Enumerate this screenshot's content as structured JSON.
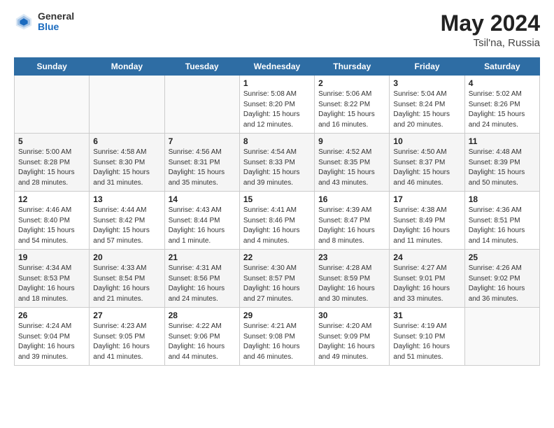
{
  "header": {
    "logo_general": "General",
    "logo_blue": "Blue",
    "month_year": "May 2024",
    "location": "Tsil'na, Russia"
  },
  "weekdays": [
    "Sunday",
    "Monday",
    "Tuesday",
    "Wednesday",
    "Thursday",
    "Friday",
    "Saturday"
  ],
  "weeks": [
    [
      {
        "day": "",
        "info": ""
      },
      {
        "day": "",
        "info": ""
      },
      {
        "day": "",
        "info": ""
      },
      {
        "day": "1",
        "info": "Sunrise: 5:08 AM\nSunset: 8:20 PM\nDaylight: 15 hours\nand 12 minutes."
      },
      {
        "day": "2",
        "info": "Sunrise: 5:06 AM\nSunset: 8:22 PM\nDaylight: 15 hours\nand 16 minutes."
      },
      {
        "day": "3",
        "info": "Sunrise: 5:04 AM\nSunset: 8:24 PM\nDaylight: 15 hours\nand 20 minutes."
      },
      {
        "day": "4",
        "info": "Sunrise: 5:02 AM\nSunset: 8:26 PM\nDaylight: 15 hours\nand 24 minutes."
      }
    ],
    [
      {
        "day": "5",
        "info": "Sunrise: 5:00 AM\nSunset: 8:28 PM\nDaylight: 15 hours\nand 28 minutes."
      },
      {
        "day": "6",
        "info": "Sunrise: 4:58 AM\nSunset: 8:30 PM\nDaylight: 15 hours\nand 31 minutes."
      },
      {
        "day": "7",
        "info": "Sunrise: 4:56 AM\nSunset: 8:31 PM\nDaylight: 15 hours\nand 35 minutes."
      },
      {
        "day": "8",
        "info": "Sunrise: 4:54 AM\nSunset: 8:33 PM\nDaylight: 15 hours\nand 39 minutes."
      },
      {
        "day": "9",
        "info": "Sunrise: 4:52 AM\nSunset: 8:35 PM\nDaylight: 15 hours\nand 43 minutes."
      },
      {
        "day": "10",
        "info": "Sunrise: 4:50 AM\nSunset: 8:37 PM\nDaylight: 15 hours\nand 46 minutes."
      },
      {
        "day": "11",
        "info": "Sunrise: 4:48 AM\nSunset: 8:39 PM\nDaylight: 15 hours\nand 50 minutes."
      }
    ],
    [
      {
        "day": "12",
        "info": "Sunrise: 4:46 AM\nSunset: 8:40 PM\nDaylight: 15 hours\nand 54 minutes."
      },
      {
        "day": "13",
        "info": "Sunrise: 4:44 AM\nSunset: 8:42 PM\nDaylight: 15 hours\nand 57 minutes."
      },
      {
        "day": "14",
        "info": "Sunrise: 4:43 AM\nSunset: 8:44 PM\nDaylight: 16 hours\nand 1 minute."
      },
      {
        "day": "15",
        "info": "Sunrise: 4:41 AM\nSunset: 8:46 PM\nDaylight: 16 hours\nand 4 minutes."
      },
      {
        "day": "16",
        "info": "Sunrise: 4:39 AM\nSunset: 8:47 PM\nDaylight: 16 hours\nand 8 minutes."
      },
      {
        "day": "17",
        "info": "Sunrise: 4:38 AM\nSunset: 8:49 PM\nDaylight: 16 hours\nand 11 minutes."
      },
      {
        "day": "18",
        "info": "Sunrise: 4:36 AM\nSunset: 8:51 PM\nDaylight: 16 hours\nand 14 minutes."
      }
    ],
    [
      {
        "day": "19",
        "info": "Sunrise: 4:34 AM\nSunset: 8:53 PM\nDaylight: 16 hours\nand 18 minutes."
      },
      {
        "day": "20",
        "info": "Sunrise: 4:33 AM\nSunset: 8:54 PM\nDaylight: 16 hours\nand 21 minutes."
      },
      {
        "day": "21",
        "info": "Sunrise: 4:31 AM\nSunset: 8:56 PM\nDaylight: 16 hours\nand 24 minutes."
      },
      {
        "day": "22",
        "info": "Sunrise: 4:30 AM\nSunset: 8:57 PM\nDaylight: 16 hours\nand 27 minutes."
      },
      {
        "day": "23",
        "info": "Sunrise: 4:28 AM\nSunset: 8:59 PM\nDaylight: 16 hours\nand 30 minutes."
      },
      {
        "day": "24",
        "info": "Sunrise: 4:27 AM\nSunset: 9:01 PM\nDaylight: 16 hours\nand 33 minutes."
      },
      {
        "day": "25",
        "info": "Sunrise: 4:26 AM\nSunset: 9:02 PM\nDaylight: 16 hours\nand 36 minutes."
      }
    ],
    [
      {
        "day": "26",
        "info": "Sunrise: 4:24 AM\nSunset: 9:04 PM\nDaylight: 16 hours\nand 39 minutes."
      },
      {
        "day": "27",
        "info": "Sunrise: 4:23 AM\nSunset: 9:05 PM\nDaylight: 16 hours\nand 41 minutes."
      },
      {
        "day": "28",
        "info": "Sunrise: 4:22 AM\nSunset: 9:06 PM\nDaylight: 16 hours\nand 44 minutes."
      },
      {
        "day": "29",
        "info": "Sunrise: 4:21 AM\nSunset: 9:08 PM\nDaylight: 16 hours\nand 46 minutes."
      },
      {
        "day": "30",
        "info": "Sunrise: 4:20 AM\nSunset: 9:09 PM\nDaylight: 16 hours\nand 49 minutes."
      },
      {
        "day": "31",
        "info": "Sunrise: 4:19 AM\nSunset: 9:10 PM\nDaylight: 16 hours\nand 51 minutes."
      },
      {
        "day": "",
        "info": ""
      }
    ]
  ]
}
